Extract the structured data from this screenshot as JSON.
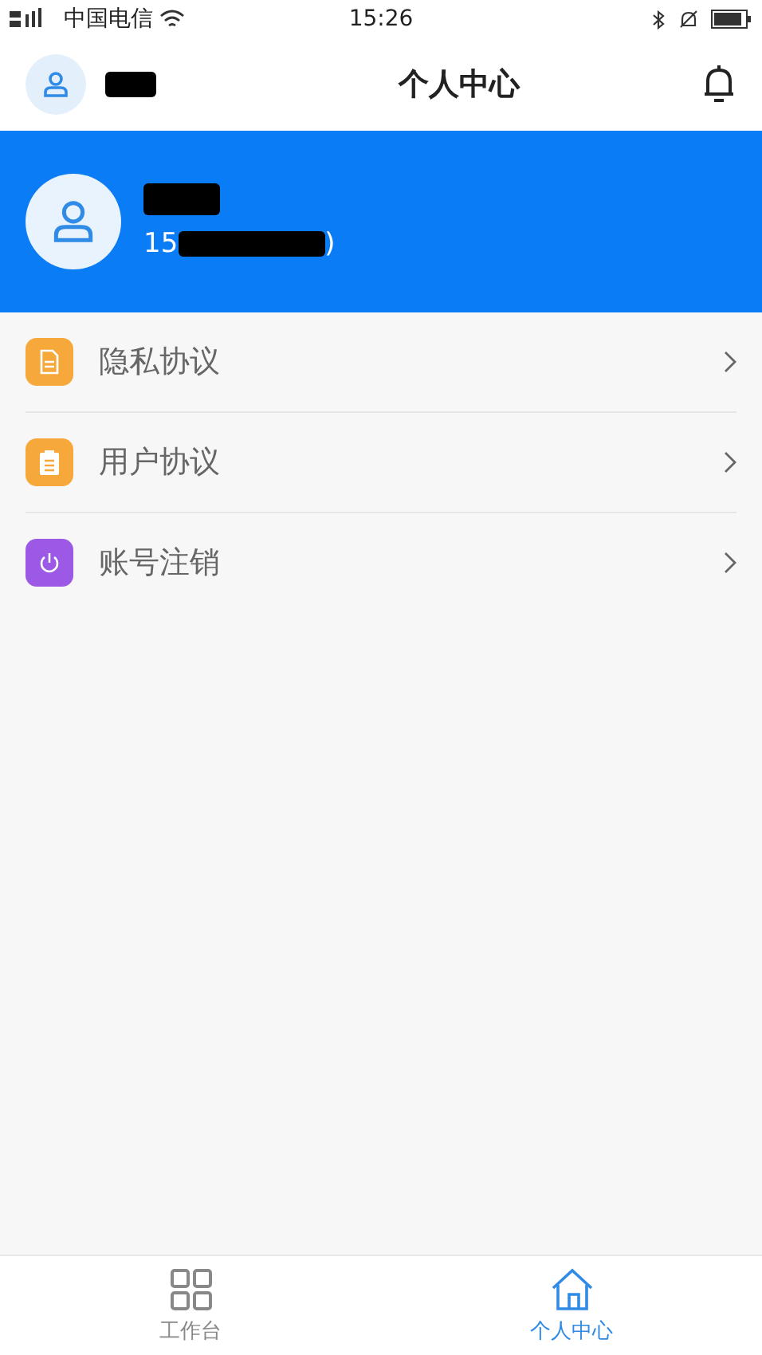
{
  "status_bar": {
    "carrier": "中国电信",
    "time": "15:26"
  },
  "header": {
    "title": "个人中心"
  },
  "profile": {
    "phone_start": "15",
    "phone_end": ")"
  },
  "menu": [
    {
      "kind": "document",
      "label": "隐私协议",
      "color": "#f7a83a"
    },
    {
      "kind": "clipboard",
      "label": "用户协议",
      "color": "#f7a83a"
    },
    {
      "kind": "power",
      "label": "账号注销",
      "color": "#9b59e6"
    }
  ],
  "tabs": [
    {
      "kind": "grid",
      "label": "工作台",
      "selected": false
    },
    {
      "kind": "home",
      "label": "个人中心",
      "selected": true
    }
  ]
}
